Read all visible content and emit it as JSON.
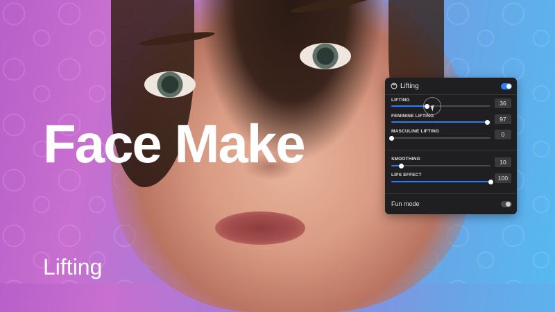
{
  "hero": {
    "title": "Face Make",
    "subtitle": "Lifting"
  },
  "panel": {
    "title": "Lifting",
    "header_icon": "face-icon",
    "header_toggle_on": true,
    "sliders": [
      {
        "label": "LIFTING",
        "value": "36",
        "fraction": 0.36
      },
      {
        "label": "FEMININE LIFTING",
        "value": "97",
        "fraction": 0.97
      },
      {
        "label": "MASCULINE LIFTING",
        "value": "0",
        "fraction": 0.0
      },
      {
        "label": "SMOOTHING",
        "value": "10",
        "fraction": 0.1
      },
      {
        "label": "LIPS EFFECT",
        "value": "100",
        "fraction": 1.0
      }
    ],
    "fun_mode": {
      "label": "Fun mode",
      "on": false
    }
  },
  "colors": {
    "accent": "#2f7cf6",
    "panel_bg": "#1f1f22"
  }
}
